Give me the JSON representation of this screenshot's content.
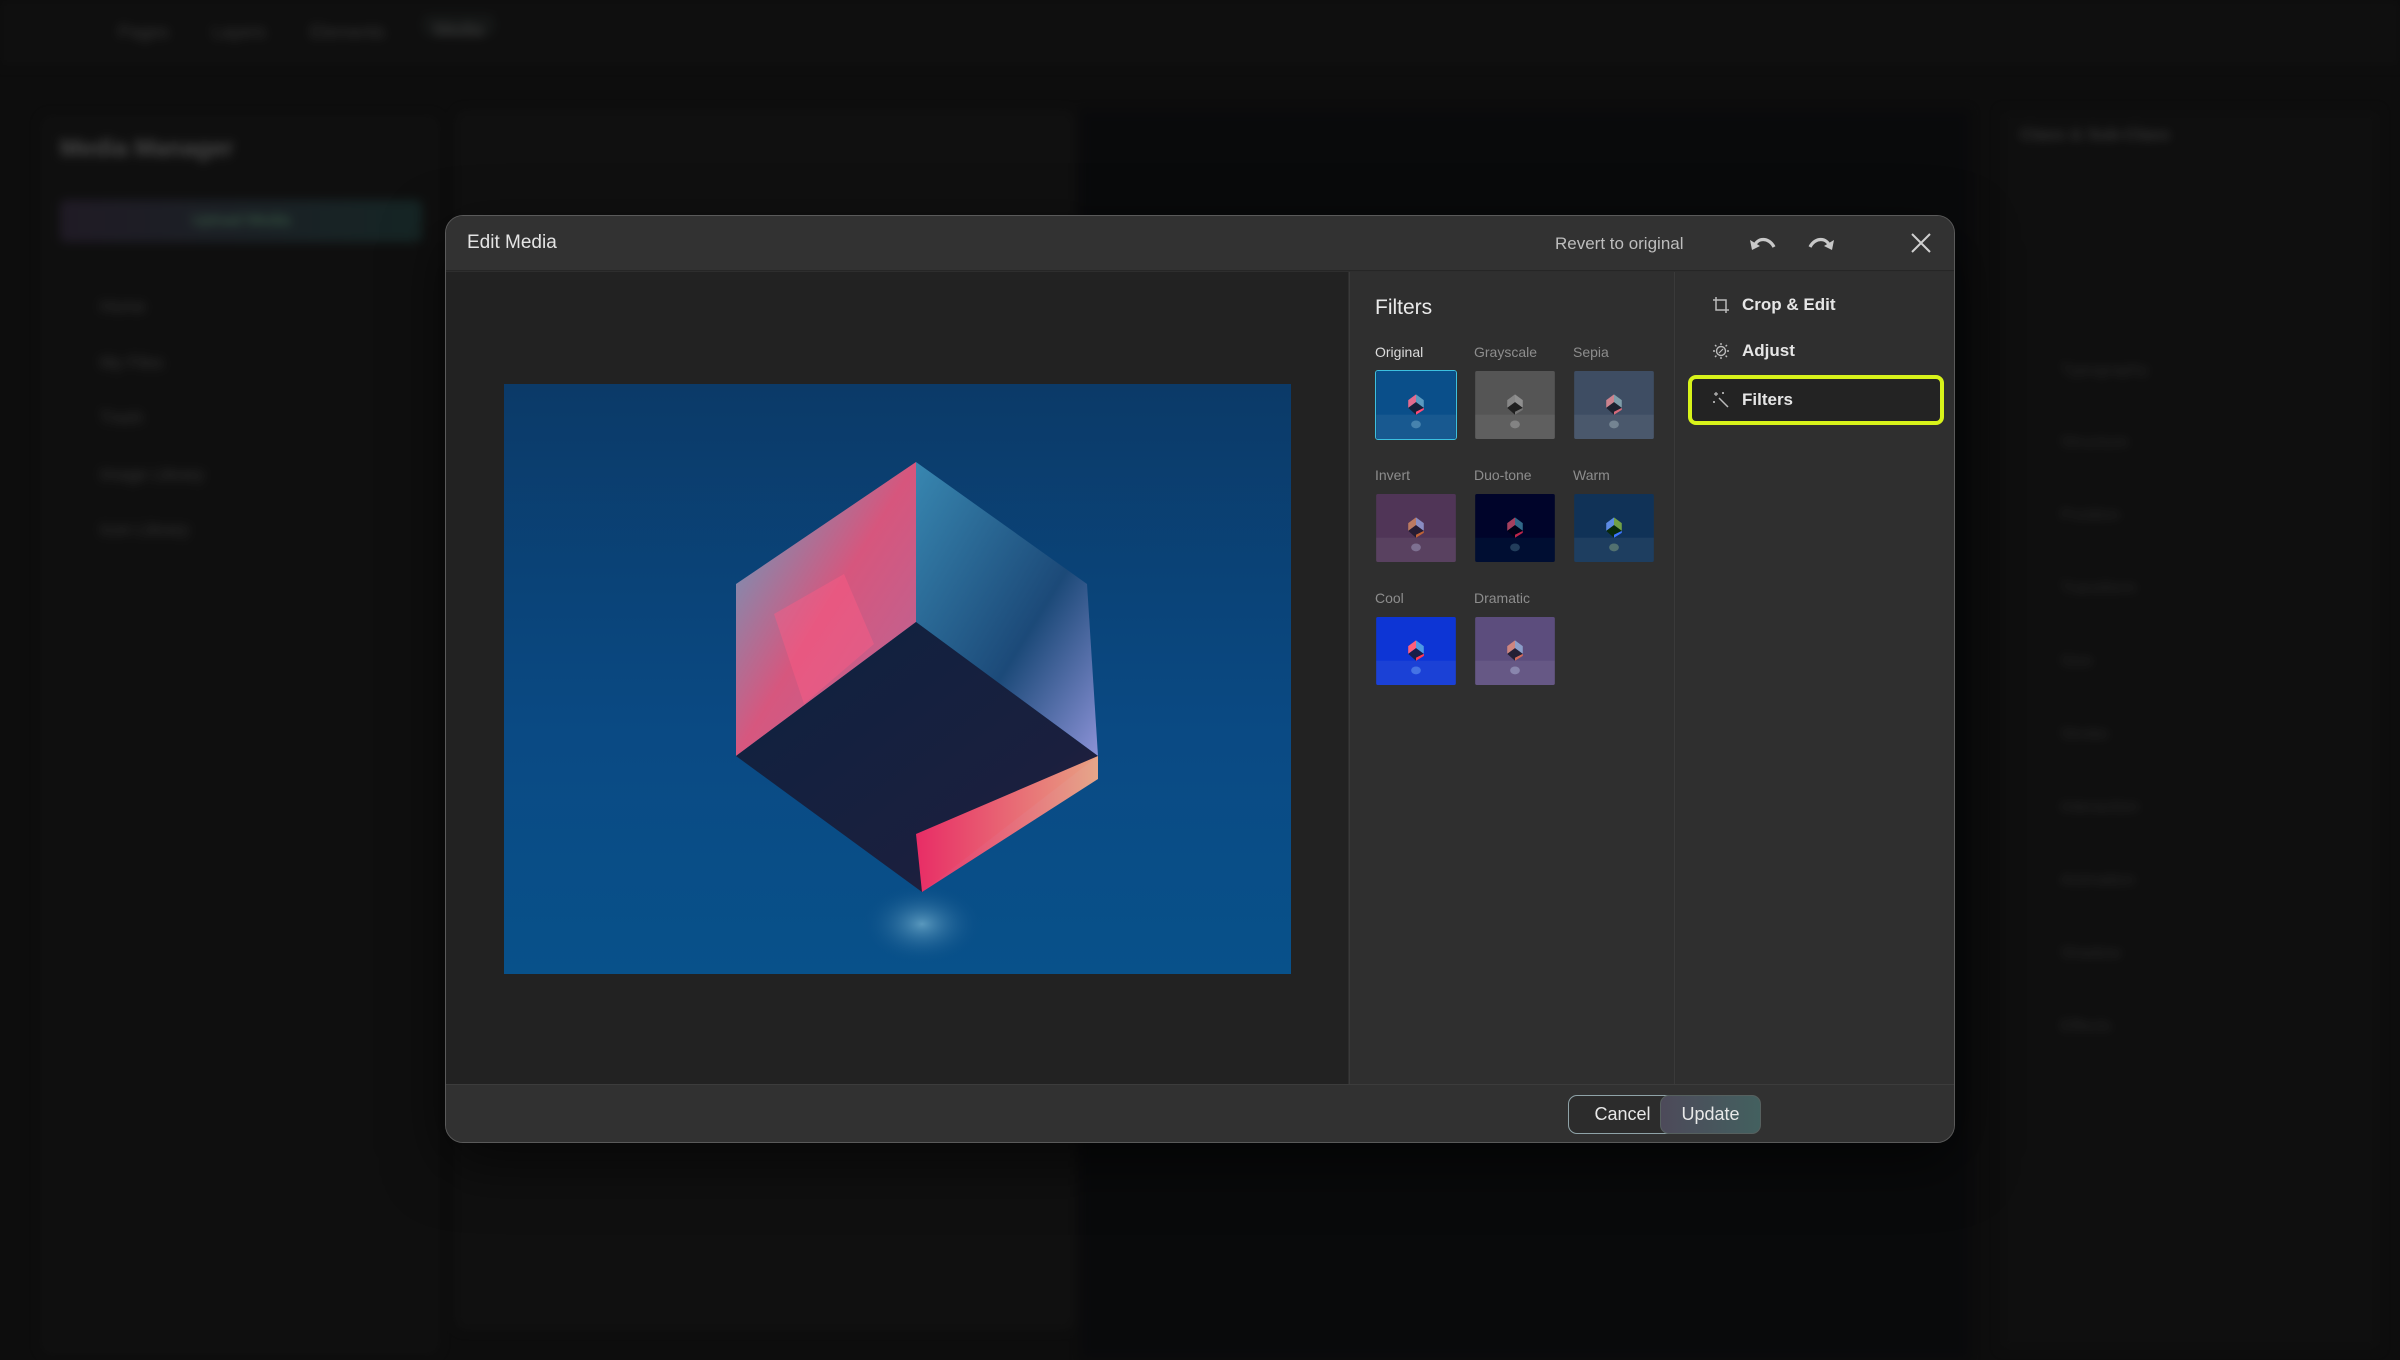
{
  "background": {
    "topbar_tabs": [
      "Pages",
      "Layers",
      "Elements",
      "Media"
    ],
    "active_tab": "Media",
    "media_manager": {
      "title": "Media Manager",
      "upload_label": "Upload Media",
      "nav": [
        "Home",
        "My Files",
        "Trash",
        "Image Library",
        "Icon Library"
      ]
    },
    "right_panel": {
      "title": "Class & Sub-Class",
      "rows": [
        "Typography",
        "Structure",
        "Position",
        "Transform",
        "Size",
        "Stroke",
        "Interaction",
        "Animation",
        "Shadow",
        "Effects"
      ]
    }
  },
  "modal": {
    "title": "Edit Media",
    "revert_label": "Revert to original",
    "undo_icon": "undo-icon",
    "redo_icon": "redo-icon",
    "close_icon": "close-icon",
    "filters": {
      "title": "Filters",
      "selected": "Original",
      "items": [
        {
          "label": "Original",
          "tint": "#0a4f8a"
        },
        {
          "label": "Grayscale",
          "tint": "#555555"
        },
        {
          "label": "Sepia",
          "tint": "#2a4a7a"
        },
        {
          "label": "Invert",
          "tint": "#3a3a6a"
        },
        {
          "label": "Duo-tone",
          "tint": "#0b2350"
        },
        {
          "label": "Warm",
          "tint": "#5a1f3a"
        },
        {
          "label": "Cool",
          "tint": "#0a3c9a"
        },
        {
          "label": "Dramatic",
          "tint": "#3d4a8a"
        }
      ]
    },
    "nav": [
      {
        "label": "Crop & Edit",
        "icon": "crop-icon"
      },
      {
        "label": "Adjust",
        "icon": "adjust-icon"
      },
      {
        "label": "Filters",
        "icon": "magic-wand-icon",
        "active": true
      }
    ],
    "footer": {
      "cancel_label": "Cancel",
      "update_label": "Update"
    },
    "colors": {
      "active_nav_border": "#d8f31a",
      "selected_filter_border": "#3cc0e0"
    }
  }
}
